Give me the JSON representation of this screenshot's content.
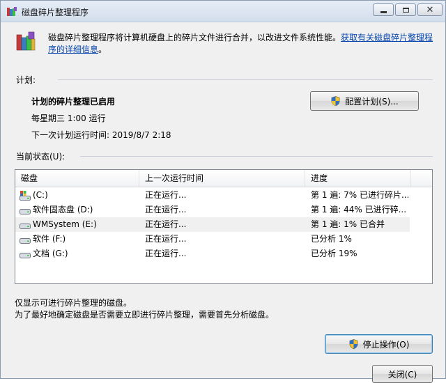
{
  "window": {
    "title": "磁盘碎片整理程序",
    "icon": "defrag-app-icon"
  },
  "intro": {
    "text": "磁盘碎片整理程序将计算机硬盘上的碎片文件进行合并，以改进文件系统性能。",
    "link": "获取有关磁盘碎片整理程序的详细信息",
    "after_link": "。"
  },
  "schedule": {
    "label": "计划:",
    "status": "计划的碎片整理已启用",
    "when": "每星期三  1:00 运行",
    "next_run": "下一次计划运行时间: 2019/8/7 2:18",
    "configure_button": "配置计划(S)..."
  },
  "current_status": {
    "label": "当前状态(U):",
    "columns": [
      "磁盘",
      "上一次运行时间",
      "进度",
      ""
    ],
    "rows": [
      {
        "name": "(C:)",
        "icon": "system-drive-icon",
        "last_run": "正在运行...",
        "progress": "第 1 遍: 7% 已进行碎片...",
        "selected": false
      },
      {
        "name": "软件固态盘 (D:)",
        "icon": "drive-icon",
        "last_run": "正在运行...",
        "progress": "第 1 遍: 44% 已进行碎...",
        "selected": false
      },
      {
        "name": "WMSystem (E:)",
        "icon": "drive-icon",
        "last_run": "正在运行...",
        "progress": "第 1 遍: 1% 已合并",
        "selected": true
      },
      {
        "name": "软件 (F:)",
        "icon": "drive-icon",
        "last_run": "正在运行...",
        "progress": "已分析 1%",
        "selected": false
      },
      {
        "name": "文档 (G:)",
        "icon": "drive-icon",
        "last_run": "正在运行...",
        "progress": "已分析 19%",
        "selected": false
      }
    ]
  },
  "info": {
    "line1": "仅显示可进行碎片整理的磁盘。",
    "line2": "为了最好地确定磁盘是否需要立即进行碎片整理，需要首先分析磁盘。"
  },
  "buttons": {
    "stop": "停止操作(O)",
    "close": "关闭(C)"
  },
  "colors": {
    "link": "#0645ad",
    "window_bg": "#f0f0f0",
    "list_bg": "#ffffff"
  }
}
